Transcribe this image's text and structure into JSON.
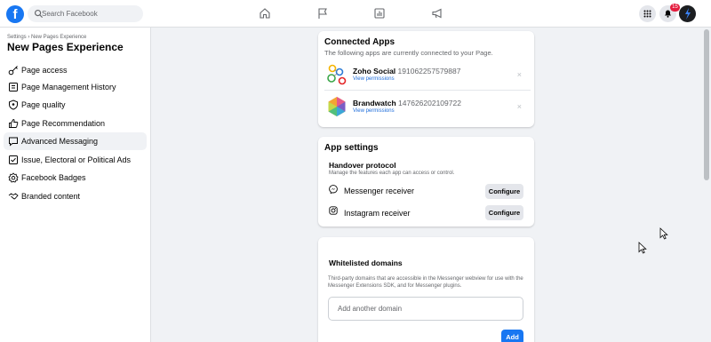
{
  "search": {
    "placeholder": "Search Facebook"
  },
  "notifications": {
    "count": "15"
  },
  "sidebar": {
    "breadcrumb": "Settings › New Pages Experience",
    "title": "New Pages Experience",
    "items": [
      {
        "label": "Page access",
        "icon": "key-icon"
      },
      {
        "label": "Page Management History",
        "icon": "history-icon"
      },
      {
        "label": "Page quality",
        "icon": "shield-icon"
      },
      {
        "label": "Page Recommendation",
        "icon": "thumb-up-icon"
      },
      {
        "label": "Advanced Messaging",
        "icon": "chat-bubble-icon",
        "active": true
      },
      {
        "label": "Issue, Electoral or Political Ads",
        "icon": "ballot-icon"
      },
      {
        "label": "Facebook Badges",
        "icon": "badge-icon"
      },
      {
        "label": "Branded content",
        "icon": "handshake-icon"
      }
    ]
  },
  "connected_apps": {
    "title": "Connected Apps",
    "subtitle": "The following apps are currently connected to your Page.",
    "apps": [
      {
        "name": "Zoho Social",
        "id": "191062257579887",
        "link": "View permissions"
      },
      {
        "name": "Brandwatch",
        "id": "147626202109722",
        "link": "View permissions"
      }
    ],
    "close_glyph": "×"
  },
  "app_settings": {
    "title": "App settings",
    "handover_title": "Handover protocol",
    "handover_sub": "Manage the features each app can access or control.",
    "receivers": [
      {
        "label": "Messenger receiver",
        "button": "Configure"
      },
      {
        "label": "Instagram receiver",
        "button": "Configure"
      }
    ]
  },
  "whitelist": {
    "title": "Whitelisted domains",
    "description": "Third-party domains that are accessible in the Messenger webview for use with the Messenger Extensions SDK, and for Messenger plugins.",
    "placeholder": "Add another domain",
    "add_button": "Add"
  },
  "colors": {
    "brand": "#1877f2",
    "link": "#216fdb",
    "badge": "#e41e3f"
  }
}
